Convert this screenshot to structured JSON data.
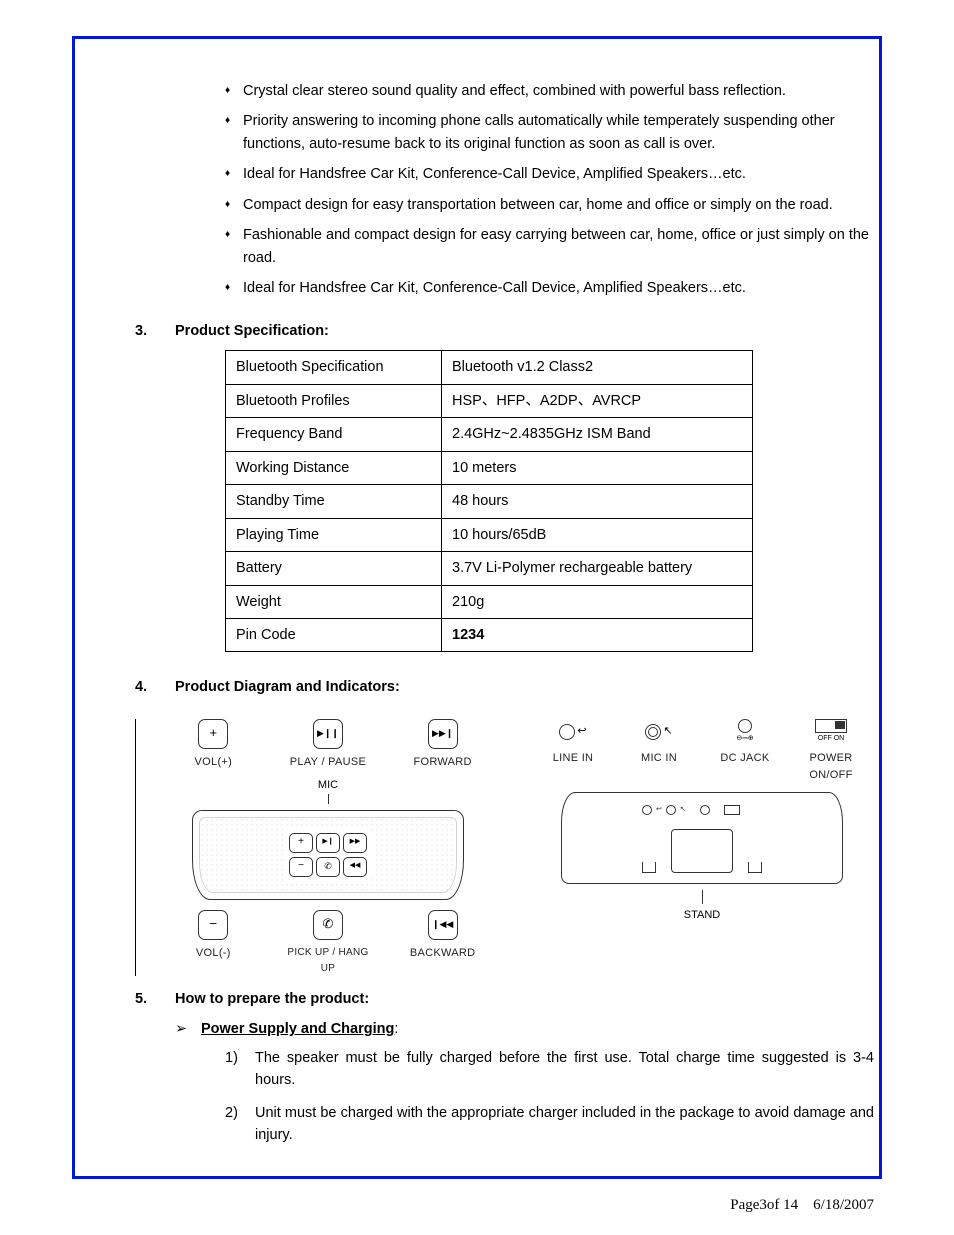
{
  "bullets": [
    "Crystal clear stereo sound quality and effect, combined with powerful bass reflection.",
    "Priority answering to incoming phone calls automatically while temperately suspending other functions, auto-resume back to its original function as soon as call is over.",
    "Ideal for Handsfree Car Kit, Conference-Call Device, Amplified Speakers…etc.",
    "Compact design for easy transportation between car, home and office or simply on the road.",
    "Fashionable and compact design for easy carrying between car, home, office or just simply on the road.",
    "Ideal for Handsfree Car Kit, Conference-Call Device, Amplified Speakers…etc."
  ],
  "sec3": {
    "num": "3.",
    "title": "Product Specification:"
  },
  "spec": [
    {
      "label": "Bluetooth Specification",
      "value": "Bluetooth v1.2   Class2"
    },
    {
      "label": "Bluetooth Profiles",
      "value": "HSP、HFP、A2DP、AVRCP"
    },
    {
      "label": "Frequency Band",
      "value": "2.4GHz~2.4835GHz ISM Band"
    },
    {
      "label": "Working Distance",
      "value": "10 meters"
    },
    {
      "label": "Standby Time",
      "value": "48 hours"
    },
    {
      "label": "Playing Time",
      "value": "10 hours/65dB"
    },
    {
      "label": "Battery",
      "value": "3.7V Li-Polymer rechargeable battery"
    },
    {
      "label": "Weight",
      "value": "210g"
    },
    {
      "label": "Pin Code",
      "value": "1234",
      "bold": true
    }
  ],
  "sec4": {
    "num": "4.",
    "title": "Product Diagram and Indicators:"
  },
  "diag": {
    "front": {
      "top": [
        {
          "icon": "+",
          "label": "VOL(+)"
        },
        {
          "icon": "▶❙❙",
          "label": "PLAY / PAUSE"
        },
        {
          "icon": "▶▶❙",
          "label": "FORWARD"
        }
      ],
      "mic": "MIC",
      "bottom": [
        {
          "icon": "−",
          "label": "VOL(-)"
        },
        {
          "icon": "✆",
          "label": "PICK UP / HANG UP"
        },
        {
          "icon": "❙◀◀",
          "label": "BACKWARD"
        }
      ]
    },
    "rear": {
      "ports": [
        {
          "label": "LINE IN"
        },
        {
          "label": "MIC  IN"
        },
        {
          "label": "DC JACK"
        },
        {
          "label_top": "OFF   ON",
          "label": "POWER ON/OFF"
        }
      ],
      "stand": "STAND"
    }
  },
  "sec5": {
    "num": "5.",
    "title": "How to prepare the product:"
  },
  "sub5": {
    "arrow": "➢",
    "label": "Power Supply and Charging",
    "colon": ":"
  },
  "prep": [
    {
      "n": "1)",
      "t": "The speaker must be fully charged before the first use. Total charge time suggested is 3-4 hours."
    },
    {
      "n": "2)",
      "t": "Unit must be charged with the appropriate charger included in the package to avoid damage and injury."
    }
  ],
  "footer": {
    "page": "Page3of  14",
    "date": "6/18/2007"
  }
}
